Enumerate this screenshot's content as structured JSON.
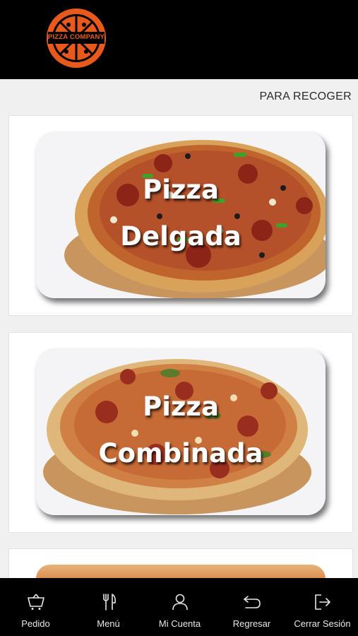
{
  "header": {
    "logo_text": "PIZZA COMPANY",
    "logo_color": "#e85a1c"
  },
  "subbar": {
    "pickup_label": "PARA RECOGER"
  },
  "menu": {
    "items": [
      {
        "title_line1": "Pizza",
        "title_line2": "Delgada"
      },
      {
        "title_line1": "Pizza",
        "title_line2": "Combinada"
      },
      {
        "title_line1": "",
        "title_line2": ""
      }
    ]
  },
  "bottom_nav": {
    "items": [
      {
        "label": "Pedido",
        "icon": "basket-icon"
      },
      {
        "label": "Menú",
        "icon": "fork-knife-icon"
      },
      {
        "label": "Mi Cuenta",
        "icon": "user-icon"
      },
      {
        "label": "Regresar",
        "icon": "return-arrow-icon"
      },
      {
        "label": "Cerrar Sesión",
        "icon": "logout-icon"
      }
    ]
  }
}
